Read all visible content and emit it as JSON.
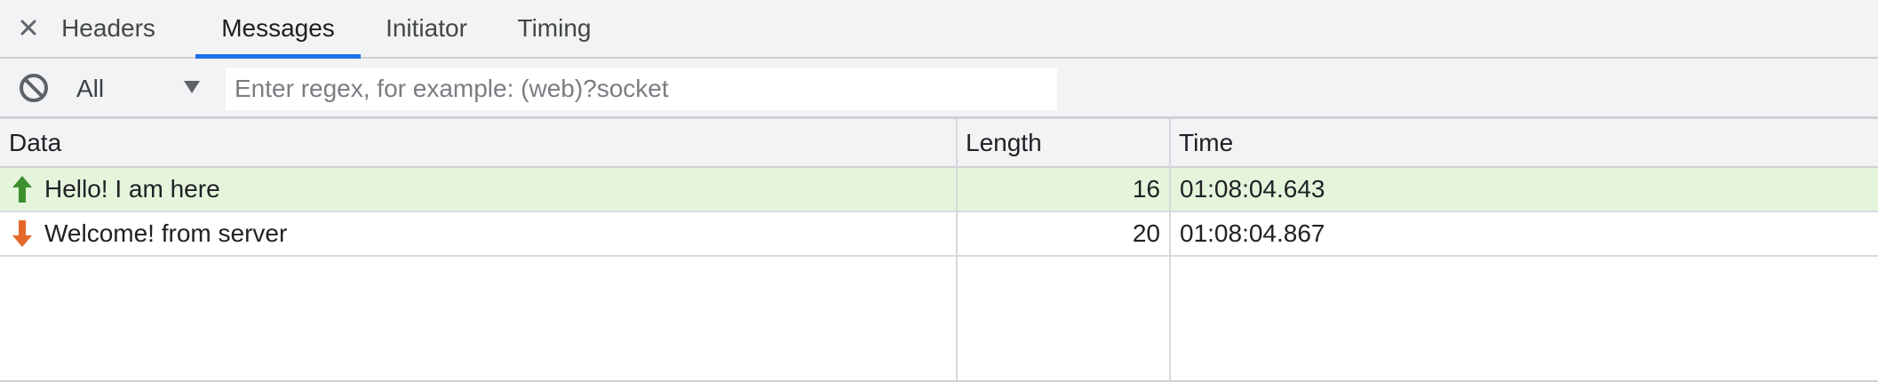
{
  "tabs": {
    "close_label": "×",
    "items": [
      {
        "label": "Headers",
        "active": false
      },
      {
        "label": "Messages",
        "active": true
      },
      {
        "label": "Initiator",
        "active": false
      },
      {
        "label": "Timing",
        "active": false
      }
    ]
  },
  "filter": {
    "clear_icon": "block-icon",
    "type_selected": "All",
    "placeholder": "Enter regex, for example: (web)?socket",
    "value": ""
  },
  "table": {
    "columns": [
      "Data",
      "Length",
      "Time"
    ],
    "rows": [
      {
        "direction": "sent",
        "icon": "arrow-up-icon",
        "data": "Hello! I am here",
        "length": "16",
        "time": "01:08:04.643"
      },
      {
        "direction": "received",
        "icon": "arrow-down-icon",
        "data": "Welcome! from server",
        "length": "20",
        "time": "01:08:04.867"
      }
    ]
  },
  "colors": {
    "accent": "#1a73e8",
    "sent_row_bg": "#e4f5dc",
    "sent_arrow": "#3d8f2e",
    "received_arrow": "#e4682a"
  }
}
